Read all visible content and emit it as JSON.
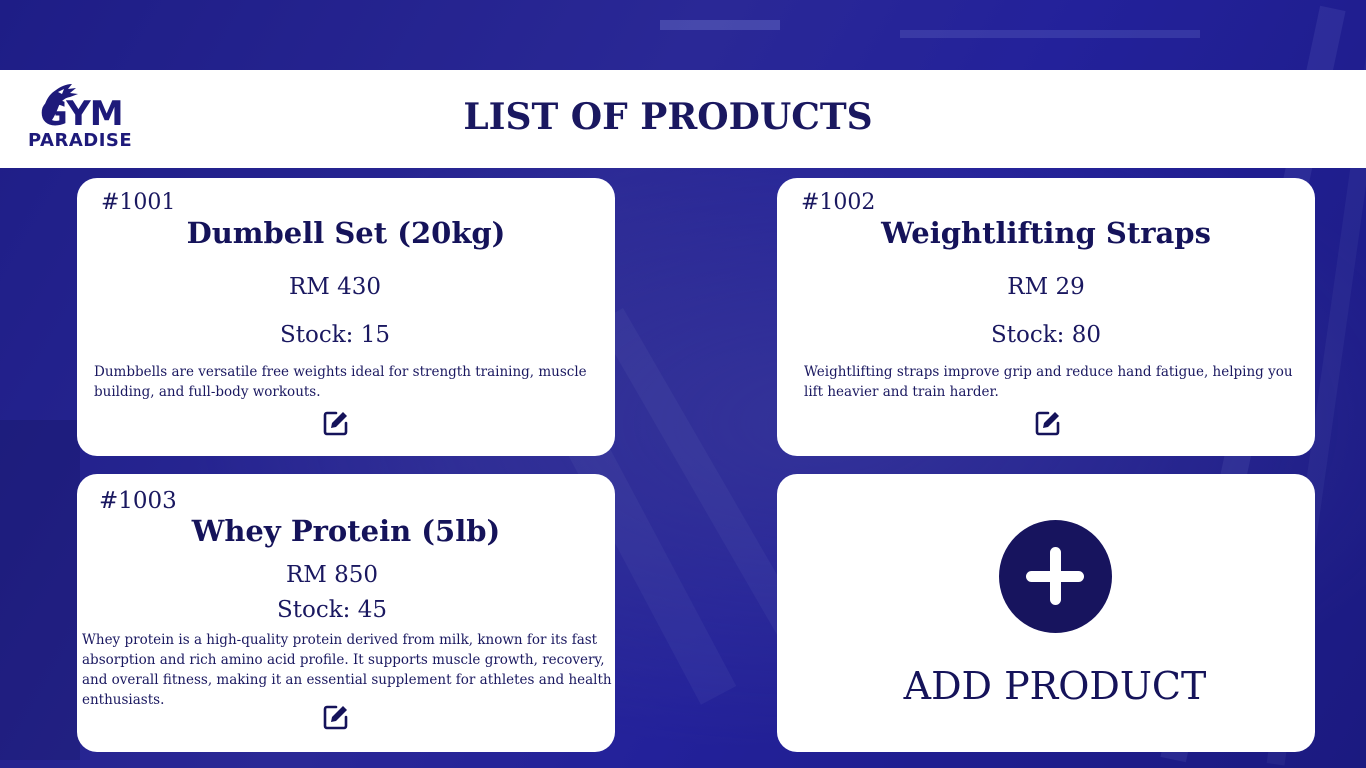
{
  "brand": {
    "line1": "GYM",
    "line2": "PARADISE"
  },
  "page_title": "LIST OF PRODUCTS",
  "products": [
    {
      "id": "#1001",
      "name": "Dumbell Set (20kg)",
      "price": "RM 430",
      "stock": "Stock: 15",
      "description": "Dumbbells are versatile free weights ideal for strength training, muscle building, and full-body workouts."
    },
    {
      "id": "#1002",
      "name": "Weightlifting Straps",
      "price": "RM 29",
      "stock": "Stock: 80",
      "description": "Weightlifting straps improve grip and reduce hand fatigue, helping you lift heavier and train harder."
    },
    {
      "id": "#1003",
      "name": "Whey Protein (5lb)",
      "price": "RM 850",
      "stock": "Stock: 45",
      "description": "Whey protein is a high-quality protein derived from milk, known for its fast absorption and rich amino acid profile. It supports muscle growth, recovery, and overall fitness, making it an essential supplement for athletes and health enthusiasts."
    }
  ],
  "add_product": {
    "label": "ADD PRODUCT",
    "icon": "plus-icon"
  },
  "icons": {
    "edit": "edit-icon",
    "logo": "dragon-logo-icon"
  },
  "colors": {
    "primary": "#17145e",
    "background": "#23219a",
    "card": "#ffffff"
  }
}
